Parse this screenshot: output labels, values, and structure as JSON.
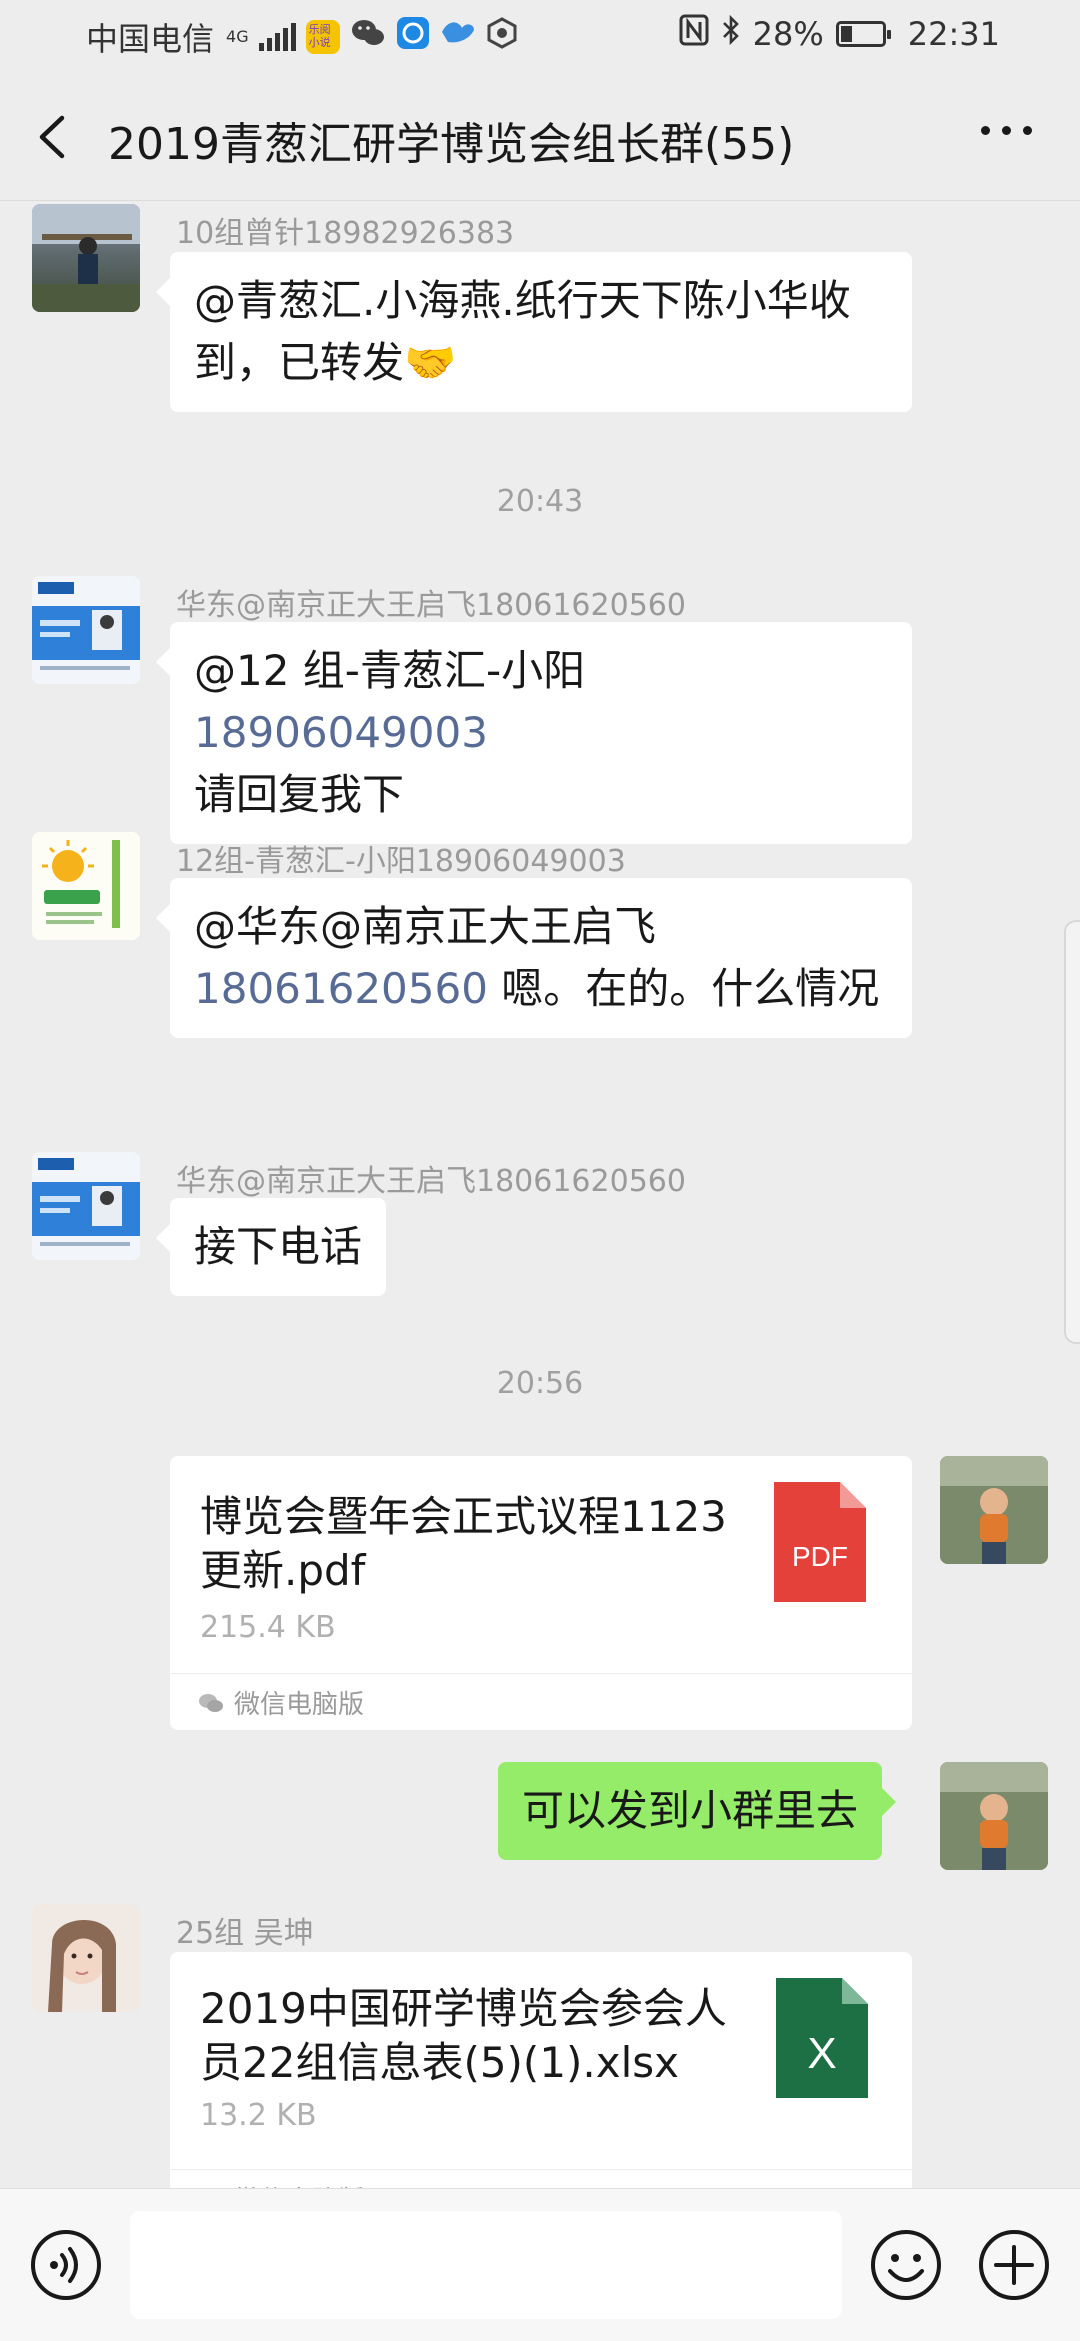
{
  "status_bar": {
    "carrier": "中国电信",
    "network": "4G",
    "battery": "28%",
    "battery_level": 0.28,
    "time": "22:31",
    "app_badge": "乐阅小说"
  },
  "header": {
    "title": "2019青葱汇研学博览会组长群(55)"
  },
  "messages": {
    "m1": {
      "sender": "10组曾针18982926383",
      "text": "@青葱汇.小海燕.纸行天下陈小华收到，已转发🤝"
    },
    "t1": "20:43",
    "m2": {
      "sender": "华东@南京正大王启飞18061620560",
      "mention": "@12 组-青葱汇-小阳",
      "phone": "18906049003",
      "text": "请回复我下"
    },
    "m3": {
      "sender": "12组-青葱汇-小阳18906049003",
      "mention": "@华东@南京正大王启飞",
      "phone": "18061620560",
      "text": " 嗯。在的。什么情况"
    },
    "m4": {
      "sender": "华东@南京正大王启飞18061620560",
      "text": "接下电话"
    },
    "t2": "20:56",
    "m5": {
      "file_name": "博览会暨年会正式议程1123更新.pdf",
      "file_size": "215.4 KB",
      "file_type": "PDF",
      "source": "微信电脑版"
    },
    "m6": {
      "text": "可以发到小群里去"
    },
    "m7": {
      "sender": "25组 吴坤",
      "file_name": "2019中国研学博览会参会人员22组信息表(5)(1).xlsx",
      "file_size": "13.2 KB",
      "file_type": "X",
      "source": "微信电脑版"
    }
  },
  "colors": {
    "background": "#ededed",
    "bubble_self": "#95ec69",
    "link": "#576b95",
    "pdf": "#e53e3e",
    "excel": "#1d7044"
  },
  "input": {
    "placeholder": ""
  }
}
